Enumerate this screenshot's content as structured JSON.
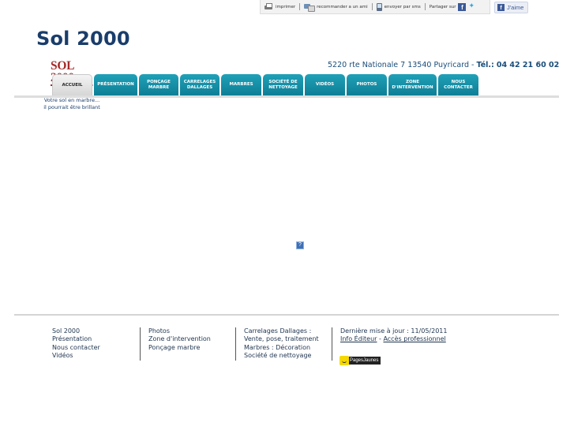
{
  "share": {
    "print": "imprimer",
    "recommend": "recommander a un ami",
    "sms": "envoyer par sms",
    "share_on": "Partager sur",
    "like": "J'aime"
  },
  "header": {
    "title": "Sol 2000",
    "logo_text": "SOL 2000",
    "address": "5220 rte Nationale 7 13540 Puyricard",
    "dash": "-",
    "tel_label": "Tél.:",
    "tel": "04 42 21 60 02"
  },
  "nav": {
    "tabs": [
      {
        "line1": "Accueil",
        "line2": ""
      },
      {
        "line1": "Présentation",
        "line2": ""
      },
      {
        "line1": "Ponçage",
        "line2": "marbre"
      },
      {
        "line1": "Carrelages",
        "line2": "Dallages"
      },
      {
        "line1": "Marbres",
        "line2": ""
      },
      {
        "line1": "Société de",
        "line2": "nettoyage"
      },
      {
        "line1": "Vidéos",
        "line2": ""
      },
      {
        "line1": "Photos",
        "line2": ""
      },
      {
        "line1": "Zone",
        "line2": "d'intervention"
      },
      {
        "line1": "Nous",
        "line2": "contacter"
      }
    ]
  },
  "tagline": {
    "line1": "Votre sol en marbre...",
    "line2": "il pourrait être brillant"
  },
  "footer": {
    "col1": [
      "Sol 2000",
      "Présentation",
      "Nous contacter",
      "Vidéos"
    ],
    "col2": [
      "Photos",
      "Zone d'intervention",
      "Ponçage marbre"
    ],
    "col3": [
      "Carrelages Dallages :",
      "Vente, pose, traitement",
      "Marbres : Décoration",
      "Société de nettoyage"
    ],
    "updated": "Dernière mise à jour : 11/05/2011",
    "info_editeur": "Info Éditeur",
    "dash": "-",
    "acces_pro": "Accès professionnel",
    "pagesjaunes": "PagesJaunes"
  },
  "colors": {
    "title": "#1a3d6b",
    "tab": "#1597ad",
    "logo": "#a52a2a"
  }
}
